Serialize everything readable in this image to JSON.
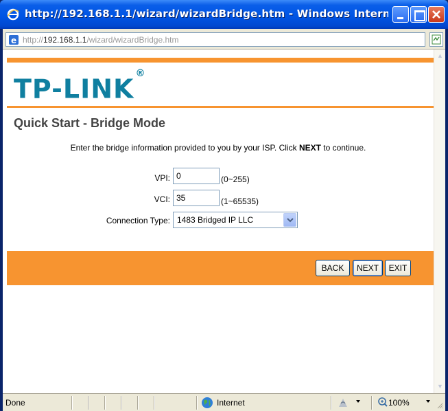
{
  "window": {
    "title": "http://192.168.1.1/wizard/wizardBridge.htm - Windows Internet ...",
    "controls": {
      "minimize": "minimize",
      "maximize": "maximize",
      "close": "close"
    }
  },
  "address": {
    "prefix": "http://",
    "host": "192.168.1.1",
    "path": "/wizard/wizardBridge.htm"
  },
  "page": {
    "logo": "TP-LINK",
    "logo_mark": "®",
    "title": "Quick Start - Bridge Mode",
    "instruction_pre": "Enter the bridge information provided to you by your ISP. Click ",
    "instruction_bold": "NEXT",
    "instruction_post": " to continue.",
    "vpi": {
      "label": "VPI:",
      "value": "0",
      "hint": "(0~255)"
    },
    "vci": {
      "label": "VCI:",
      "value": "35",
      "hint": "(1~65535)"
    },
    "connection_type": {
      "label": "Connection Type:",
      "selected": "1483 Bridged IP LLC"
    },
    "buttons": {
      "back": "BACK",
      "next": "NEXT",
      "exit": "EXIT"
    }
  },
  "status": {
    "text": "Done",
    "zone": "Internet",
    "zoom": "100%"
  },
  "colors": {
    "accent_orange": "#f79430",
    "logo_blue": "#0f7fa0",
    "titlebar_blue": "#0055e5"
  },
  "icons": [
    "ie-icon",
    "page-icon",
    "refresh-icon",
    "globe-icon",
    "protected-mode-icon",
    "zoom-icon"
  ]
}
